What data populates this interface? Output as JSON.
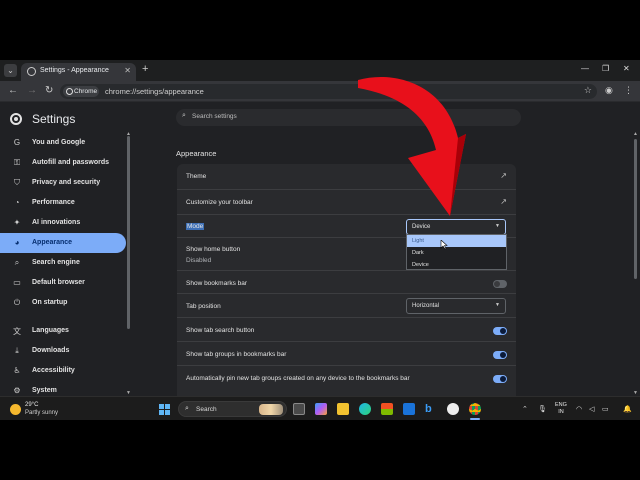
{
  "browser": {
    "tab_menu_icon": "chevron-down-icon",
    "tab_title": "Settings - Appearance",
    "tab_close": "✕",
    "new_tab": "+",
    "chip_label": "Chrome",
    "url": "chrome://settings/appearance"
  },
  "settings": {
    "title": "Settings",
    "search_placeholder": "Search settings"
  },
  "nav": {
    "items": [
      {
        "label": "You and Google",
        "icon": "google-icon"
      },
      {
        "label": "Autofill and passwords",
        "icon": "key-icon"
      },
      {
        "label": "Privacy and security",
        "icon": "shield-icon"
      },
      {
        "label": "Performance",
        "icon": "speedometer-icon"
      },
      {
        "label": "AI innovations",
        "icon": "sparkle-icon"
      },
      {
        "label": "Appearance",
        "icon": "palette-icon"
      },
      {
        "label": "Search engine",
        "icon": "search-icon"
      },
      {
        "label": "Default browser",
        "icon": "browser-icon"
      },
      {
        "label": "On startup",
        "icon": "power-icon"
      },
      {
        "label": "Languages",
        "icon": "language-icon"
      },
      {
        "label": "Downloads",
        "icon": "download-icon"
      },
      {
        "label": "Accessibility",
        "icon": "accessibility-icon"
      },
      {
        "label": "System",
        "icon": "wrench-icon"
      }
    ]
  },
  "appearance": {
    "section_title": "Appearance",
    "rows": {
      "theme": "Theme",
      "customize_toolbar": "Customize your toolbar",
      "mode": "Mode",
      "mode_value": "Device",
      "show_home": "Show home button",
      "show_home_sub": "Disabled",
      "show_bookmarks": "Show bookmarks bar",
      "tab_position": "Tab position",
      "tab_position_value": "Horizontal",
      "tab_search": "Show tab search button",
      "tab_groups": "Show tab groups in bookmarks bar",
      "auto_pin": "Automatically pin new tab groups created on any device to the bookmarks bar"
    },
    "toggles": {
      "show_bookmarks": false,
      "tab_search": true,
      "tab_groups": true,
      "auto_pin": true
    },
    "mode_options": [
      "Light",
      "Dark",
      "Device"
    ]
  },
  "taskbar": {
    "temperature": "29°C",
    "weather": "Partly sunny",
    "search_label": "Search",
    "lang_line1": "ENG",
    "lang_line2": "IN"
  },
  "colors": {
    "accent": "#7cacf8",
    "arrow": "#e8101b"
  }
}
